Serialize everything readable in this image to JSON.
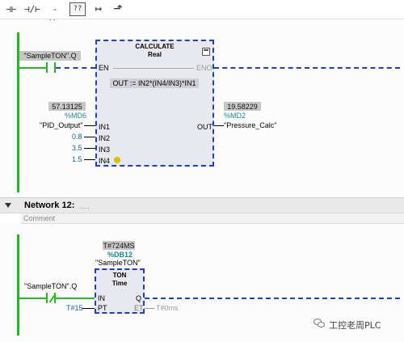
{
  "toolbar": {
    "buttons": [
      {
        "name": "no-contact-button",
        "glyph": "⊣⊢"
      },
      {
        "name": "nc-contact-button",
        "glyph": "⊣/⊢"
      },
      {
        "name": "coil-button",
        "glyph": "-()-"
      },
      {
        "name": "empty-box-button",
        "glyph": "??"
      },
      {
        "name": "open-branch-button",
        "glyph": "↦"
      },
      {
        "name": "close-branch-button",
        "glyph": "⬏"
      }
    ]
  },
  "network11": {
    "contact_tag": "\"SampleTON\".Q",
    "block_title": "CALCULATE",
    "block_type": "Real",
    "en": "EN",
    "eno": "ENO",
    "formula": "OUT := IN2*(IN4/IN3)*IN1",
    "in1_value": "57.13125",
    "in1_addr": "%MD6",
    "in1_tag": "\"PID_Output\"",
    "in1_label": "IN1",
    "in2_value": "0.8",
    "in2_label": "IN2",
    "in3_value": "3.5",
    "in3_label": "IN3",
    "in4_value": "1.5",
    "in4_label": "IN4",
    "out_label": "OUT",
    "out_value": "19.58229",
    "out_addr": "%MD2",
    "out_tag": "\"Pressure_Calc\""
  },
  "network12": {
    "title": "Network 12:",
    "title_suffix": ".....",
    "comment": "Comment",
    "instance_value": "T#724MS",
    "instance_db": "%DB12",
    "instance_name": "\"SampleTON\"",
    "contact_tag": "\"SampleTON\".Q",
    "block_title": "TON",
    "block_type": "Time",
    "in_label": "IN",
    "pt_label": "PT",
    "q_label": "Q",
    "et_label": "ET",
    "pt_value": "T#15",
    "et_value": "T#0ms"
  },
  "watermark": {
    "text": "工控老周PLC"
  },
  "colors": {
    "rail_green": "#22bb22",
    "dashed_blue": "#1f3fcf",
    "value_blue": "#1d5db8",
    "addr_teal": "#1b8c86"
  }
}
